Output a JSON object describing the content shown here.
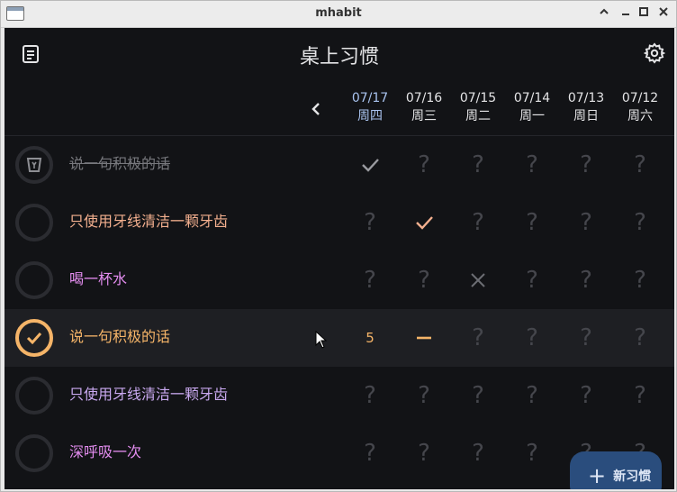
{
  "window": {
    "title": "mhabit",
    "controls": [
      "chevron-up-icon",
      "minimize-icon",
      "maximize-icon",
      "close-icon"
    ]
  },
  "header": {
    "title": "桌上习惯",
    "menu_icon": "list-icon",
    "settings_icon": "gear-icon"
  },
  "date_nav": {
    "prev_icon": "chevron-left-icon"
  },
  "dates": [
    {
      "date": "07/17",
      "weekday": "周四",
      "today": true
    },
    {
      "date": "07/16",
      "weekday": "周三",
      "today": false
    },
    {
      "date": "07/15",
      "weekday": "周二",
      "today": false
    },
    {
      "date": "07/14",
      "weekday": "周一",
      "today": false
    },
    {
      "date": "07/13",
      "weekday": "周日",
      "today": false
    },
    {
      "date": "07/12",
      "weekday": "周六",
      "today": false
    }
  ],
  "habits": [
    {
      "name": "说一句积极的话",
      "color": "#77787d",
      "status": "archived",
      "cells": [
        "check",
        "?",
        "?",
        "?",
        "?",
        "?"
      ]
    },
    {
      "name": "只使用牙线清洁一颗牙齿",
      "color": "#f4b08f",
      "status": "none",
      "cells": [
        "?",
        "check",
        "?",
        "?",
        "?",
        "?"
      ]
    },
    {
      "name": "喝一杯水",
      "color": "#e48df0",
      "status": "none",
      "cells": [
        "?",
        "?",
        "cross",
        "?",
        "?",
        "?"
      ]
    },
    {
      "name": "说一句积极的话",
      "color": "#f5b468",
      "status": "done",
      "selected": true,
      "cells": [
        "5",
        "dash",
        "?",
        "?",
        "?",
        "?"
      ]
    },
    {
      "name": "只使用牙线清洁一颗牙齿",
      "color": "#c9a9f0",
      "status": "none",
      "cells": [
        "?",
        "?",
        "?",
        "?",
        "?",
        "?"
      ]
    },
    {
      "name": "深呼吸一次",
      "color": "#e48df0",
      "status": "none",
      "cells": [
        "?",
        "?",
        "?",
        "?",
        "?",
        "?"
      ]
    }
  ],
  "cell_colors": {
    "check_done": "#f4b08f",
    "check_archived": "#9a9ba0",
    "dash": "#f5b468",
    "cross": "#6c6d73",
    "unknown": "#45464c"
  },
  "fab": {
    "label": "新习惯",
    "icon": "plus-icon",
    "color": "#2a4d7d"
  }
}
